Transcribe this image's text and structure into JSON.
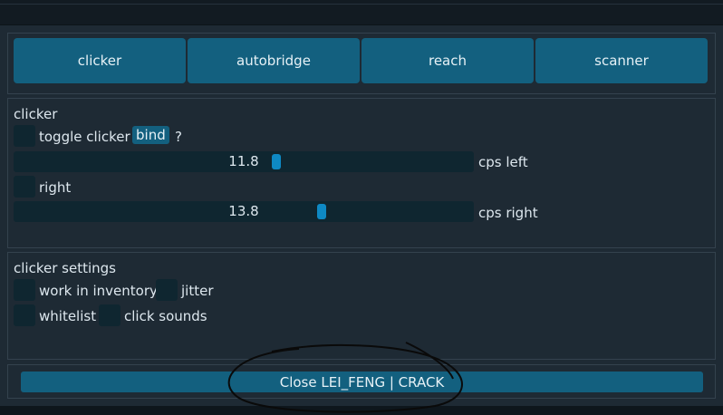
{
  "tabs": [
    {
      "label": "clicker"
    },
    {
      "label": "autobridge"
    },
    {
      "label": "reach"
    },
    {
      "label": "scanner"
    }
  ],
  "clicker": {
    "title": "clicker",
    "toggle_label": "toggle clicker",
    "bind_label": "bind",
    "help_label": "?",
    "cps_left": {
      "value": "11.8",
      "label": "cps left",
      "fraction": 0.57
    },
    "right_label": "right",
    "cps_right": {
      "value": "13.8",
      "label": "cps right",
      "fraction": 0.67
    }
  },
  "settings": {
    "title": "clicker settings",
    "work_in_inventory": "work in inventory",
    "jitter": "jitter",
    "whitelist": "whitelist",
    "click_sounds": "click sounds"
  },
  "close_label": "Close LEI_FENG | CRACK",
  "colors": {
    "accent": "#13607f",
    "knob": "#0e89c4",
    "background": "#1e2a34"
  }
}
